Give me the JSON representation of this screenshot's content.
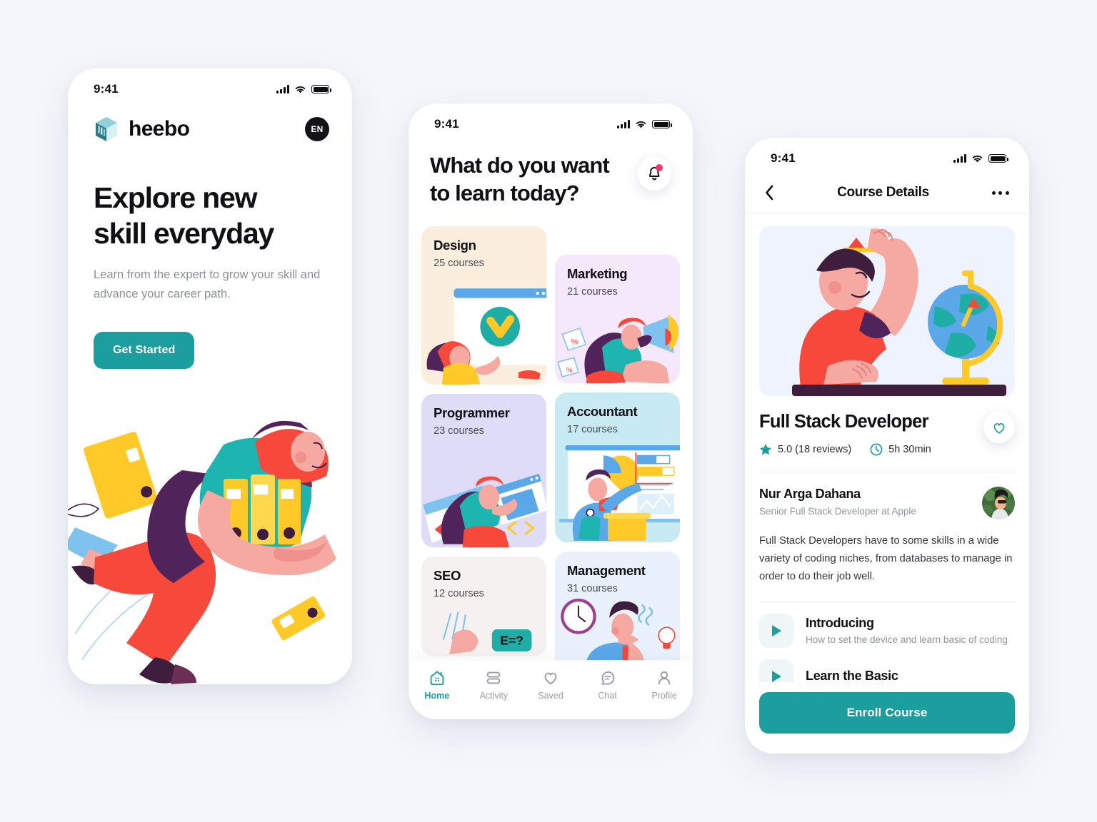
{
  "statusbar": {
    "time": "9:41"
  },
  "phone1": {
    "brand": "heebo",
    "lang": "EN",
    "headline_line1": "Explore new",
    "headline_line2": "skill everyday",
    "subtitle": "Learn from the expert to grow your skill and advance your career path.",
    "cta_label": "Get Started"
  },
  "phone2": {
    "heading_line1": "What do you want",
    "heading_line2": "to learn today?",
    "categories": [
      {
        "title": "Design",
        "count": "25 courses",
        "bg": "#fbeedd",
        "art": "design"
      },
      {
        "title": "Marketing",
        "count": "21 courses",
        "bg": "#f6e8fb",
        "art": "marketing"
      },
      {
        "title": "Programmer",
        "count": "23 courses",
        "bg": "#dedcf7",
        "art": "programmer"
      },
      {
        "title": "Accountant",
        "count": "17 courses",
        "bg": "#c8eaf3",
        "art": "accountant"
      },
      {
        "title": "SEO",
        "count": "12 courses",
        "bg": "#f6f1f1",
        "art": "seo"
      },
      {
        "title": "Management",
        "count": "31 courses",
        "bg": "#e9f2fc",
        "art": "management"
      }
    ],
    "tabs": [
      {
        "label": "Home",
        "icon": "home-icon",
        "active": true
      },
      {
        "label": "Activity",
        "icon": "activity-icon",
        "active": false
      },
      {
        "label": "Saved",
        "icon": "heart-icon",
        "active": false
      },
      {
        "label": "Chat",
        "icon": "chat-icon",
        "active": false
      },
      {
        "label": "Profile",
        "icon": "profile-icon",
        "active": false
      }
    ]
  },
  "phone3": {
    "nav_title": "Course Details",
    "course_title": "Full Stack Developer",
    "rating": "5.0 (18 reviews)",
    "duration": "5h 30min",
    "teacher_name": "Nur Arga Dahana",
    "teacher_role": "Senior Full Stack Developer at Apple",
    "description": "Full Stack Developers have to some skills in a wide variety of coding niches, from databases to manage in order to do their job well.",
    "lessons": [
      {
        "title": "Introducing",
        "subtitle": "How to set the device and learn basic of coding"
      },
      {
        "title": "Learn the Basic",
        "subtitle": ""
      }
    ],
    "enroll_label": "Enroll Course"
  },
  "colors": {
    "accent": "#1d9e9e",
    "page_bg": "#f5f6fb",
    "badge": "#f8366b",
    "text": "#101015",
    "muted": "#9093a0"
  }
}
